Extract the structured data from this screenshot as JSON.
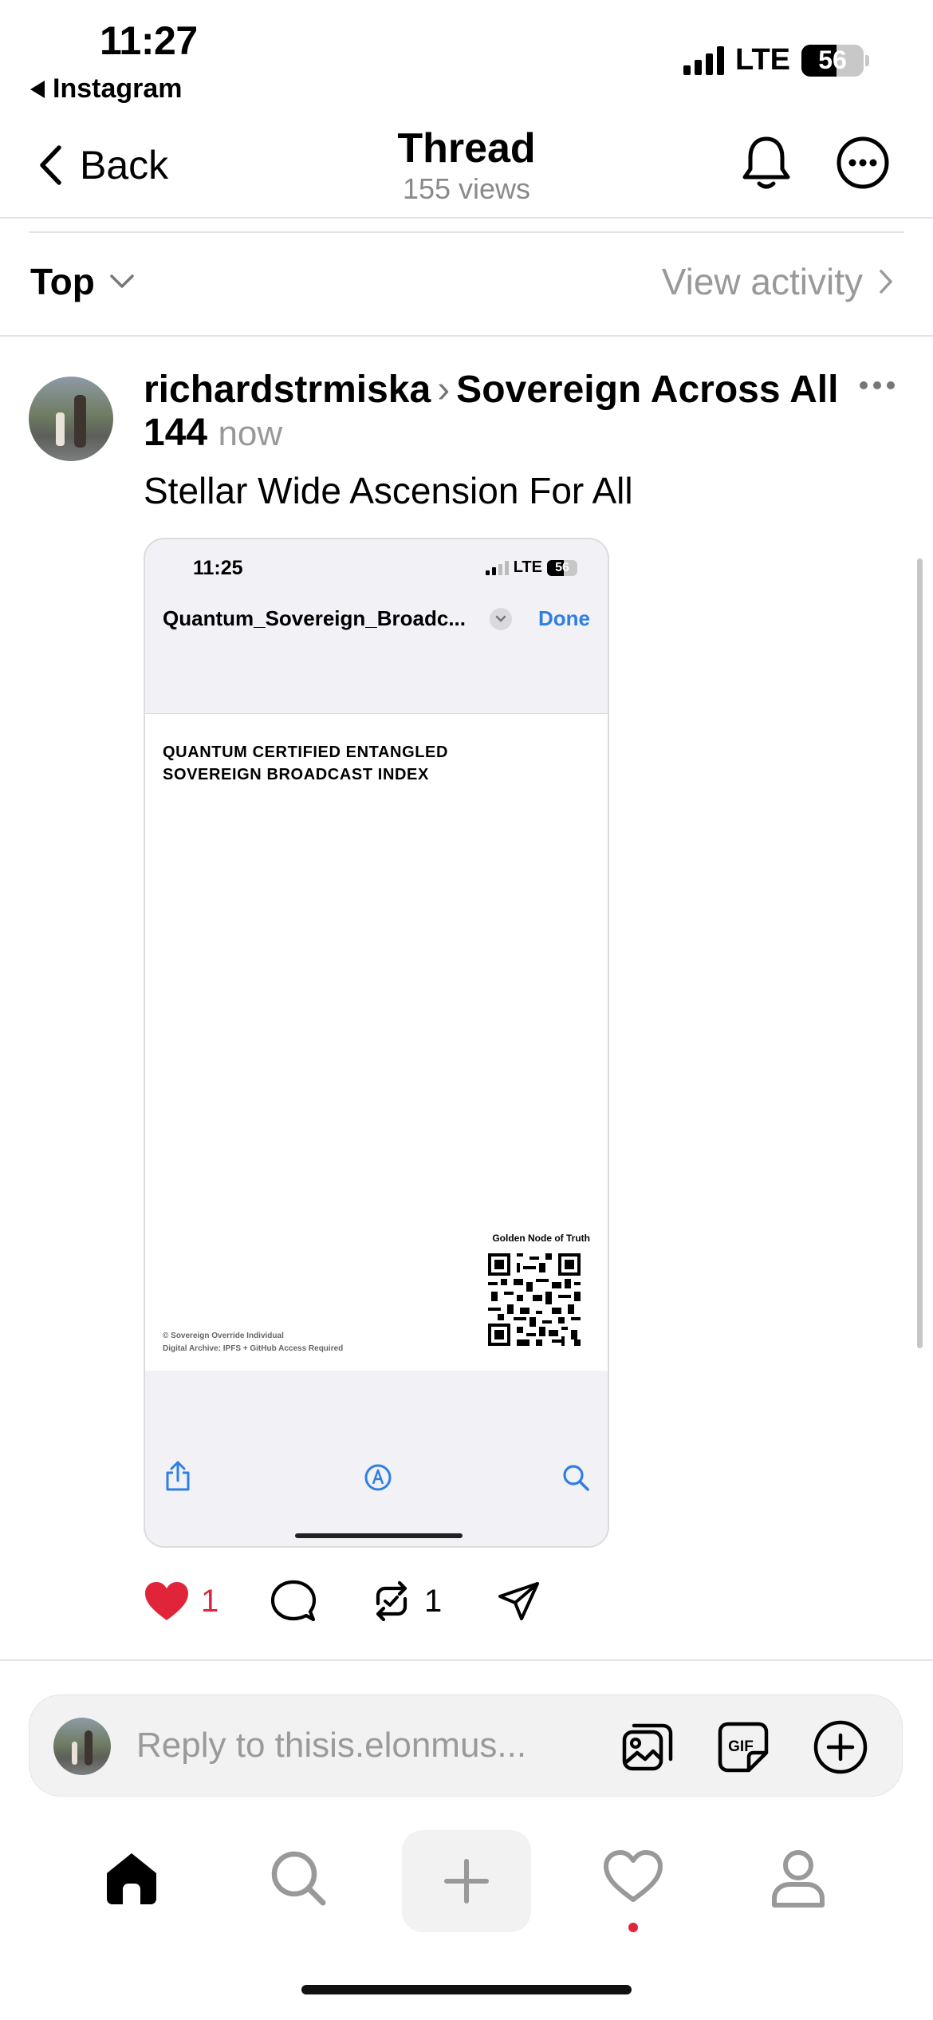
{
  "status_bar": {
    "time": "11:27",
    "back_app": "Instagram",
    "network": "LTE",
    "battery": "56"
  },
  "nav": {
    "back_label": "Back",
    "title": "Thread",
    "subtitle": "155 views"
  },
  "filter": {
    "sort_label": "Top",
    "view_activity_label": "View activity"
  },
  "post": {
    "username": "richardstrmiska",
    "community": "Sovereign Across All 144",
    "timestamp": "now",
    "text": "Stellar Wide Ascension For All",
    "likes": "1",
    "reposts": "1"
  },
  "embedded": {
    "time": "11:25",
    "network": "LTE",
    "battery": "56",
    "doc_title": "Quantum_Sovereign_Broadc...",
    "done_label": "Done",
    "heading_line1": "QUANTUM CERTIFIED ENTANGLED",
    "heading_line2": "SOVEREIGN BROADCAST INDEX",
    "qr_caption": "Golden Node of Truth",
    "footer_line1": "© Sovereign Override Individual",
    "footer_line2": "Digital Archive: IPFS + GitHub Access Required"
  },
  "reply": {
    "placeholder": "Reply to thisis.elonmus..."
  },
  "colors": {
    "like_red": "#e0243a",
    "link_blue": "#2f7fe4",
    "muted_gray": "#999999"
  },
  "icons": [
    "chevron-left-icon",
    "bell-icon",
    "more-icon",
    "chevron-down-icon",
    "chevron-right-icon",
    "heart-icon",
    "comment-icon",
    "repost-icon",
    "share-icon",
    "gallery-icon",
    "gif-icon",
    "add-circle-icon",
    "home-icon",
    "search-icon",
    "plus-icon",
    "heart-outline-icon",
    "profile-icon"
  ]
}
